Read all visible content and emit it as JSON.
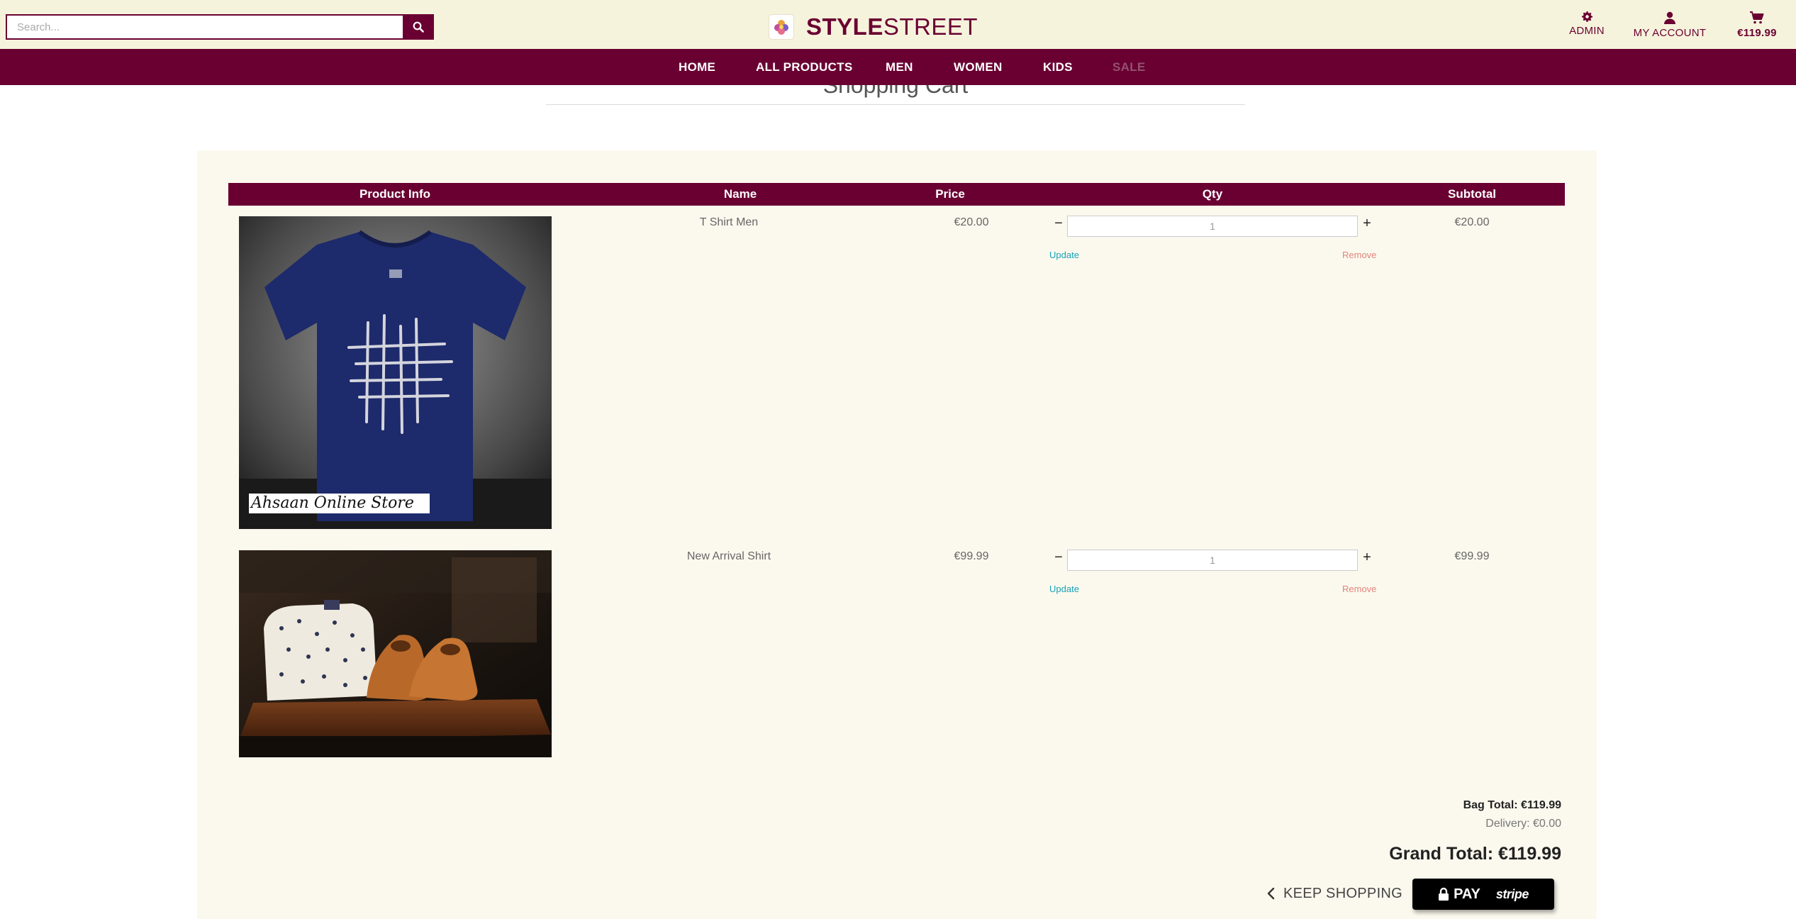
{
  "search": {
    "placeholder": "Search..."
  },
  "brand": {
    "bold": "STYLE",
    "light": "STREET"
  },
  "header": {
    "admin_label": "ADMIN",
    "account_label": "MY ACCOUNT",
    "cart_total": "€119.99"
  },
  "nav": {
    "items": [
      "HOME",
      "ALL PRODUCTS",
      "MEN",
      "WOMEN",
      "KIDS",
      "SALE"
    ]
  },
  "page": {
    "title": "Shopping Cart"
  },
  "table": {
    "headers": [
      "Product Info",
      "Name",
      "Price",
      "Qty",
      "Subtotal"
    ]
  },
  "items": [
    {
      "image_caption": "Ahsaan Online Store",
      "name": "T Shirt Men",
      "price": "€20.00",
      "qty": "1",
      "update_label": "Update",
      "remove_label": "Remove",
      "subtotal": "€20.00"
    },
    {
      "name": "New Arrival Shirt",
      "price": "€99.99",
      "qty": "1",
      "update_label": "Update",
      "remove_label": "Remove",
      "subtotal": "€99.99"
    }
  ],
  "summary": {
    "bag_total": "Bag Total: €119.99",
    "delivery": "Delivery: €0.00",
    "grand_total": "Grand Total: €119.99"
  },
  "actions": {
    "keep_shopping": "KEEP SHOPPING",
    "pay_label": "PAY",
    "pay_brand": "stripe"
  },
  "colors": {
    "brand_primary": "#6a0032",
    "header_bg": "#f6f3dc",
    "panel_bg": "#fbf9ee",
    "update_link": "#17a2b8",
    "remove_link": "#e4837a"
  }
}
